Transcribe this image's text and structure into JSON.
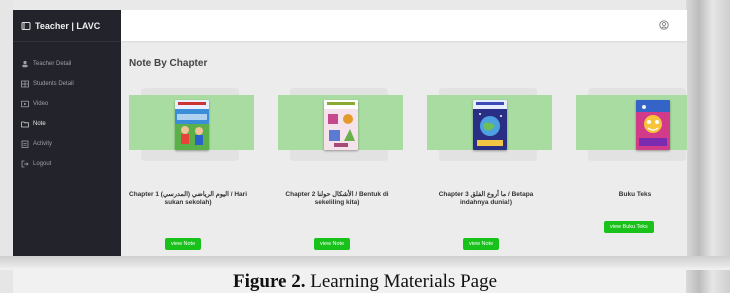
{
  "sidebar": {
    "brand": "Teacher | LAVC",
    "items": [
      {
        "label": "Teacher Detail",
        "icon": "person-icon"
      },
      {
        "label": "Students Detail",
        "icon": "group-icon"
      },
      {
        "label": "Video",
        "icon": "video-icon"
      },
      {
        "label": "Note",
        "icon": "note-icon"
      },
      {
        "label": "Activity",
        "icon": "clipboard-icon"
      },
      {
        "label": "Logout",
        "icon": "logout-icon"
      }
    ]
  },
  "header": {
    "user_icon": "user-circle-icon"
  },
  "main": {
    "title": "Note By Chapter",
    "cards": [
      {
        "title": "Chapter 1 اليوم الرياضي (المدرسي) / Hari sukan sekolah)",
        "button": "view Note"
      },
      {
        "title": "Chapter 2 الأشكال حولنا / Bentuk di sekeliling kita)",
        "button": "view Note"
      },
      {
        "title": "Chapter 3 ما أروع الفلق / Betapa indahnya dunia!)",
        "button": "view Note"
      },
      {
        "title": "Buku Teks",
        "button": "view Buku Teks"
      }
    ]
  },
  "figure": {
    "label": "Figure 2.",
    "text": "Learning Materials Page"
  },
  "colors": {
    "sidebar": "#22232b",
    "band": "#a9dca0",
    "button": "#18c21a"
  }
}
